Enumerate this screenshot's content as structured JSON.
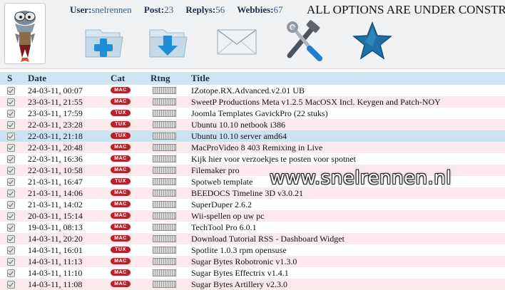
{
  "header": {
    "user_label": "User:",
    "user_value": "snelrennen",
    "post_label": "Post:",
    "post_value": "23",
    "replys_label": "Replys:",
    "replys_value": "56",
    "webbies_label": "Webbies:",
    "webbies_value": "67",
    "ticker": "ALL OPTIONS ARE UNDER CONSTRUC"
  },
  "toolbar": [
    "add-post-icon",
    "download-icon",
    "mail-icon",
    "tools-icon",
    "favorite-star-icon"
  ],
  "columns": {
    "s": "S",
    "date": "Date",
    "cat": "Cat",
    "rating": "Rtng",
    "title": "Title"
  },
  "rows": [
    {
      "date": "24-03-11, 00:07",
      "cat": "MAC",
      "title": "IZotope.RX.Advanced.v2.01 UB"
    },
    {
      "date": "23-03-11, 21:55",
      "cat": "MAC",
      "title": "SweetP Productions Meta v1.2.5 MacOSX Incl. Keygen and Patch-NOY"
    },
    {
      "date": "23-03-11, 17:59",
      "cat": "TUX",
      "title": "Joomla Templates GavickPro (22 stuks)"
    },
    {
      "date": "22-03-11, 23:28",
      "cat": "TUX",
      "title": "Ubuntu 10.10 netbook i386"
    },
    {
      "date": "22-03-11, 21:18",
      "cat": "TUX",
      "title": "Ubuntu 10.10 server amd64"
    },
    {
      "date": "22-03-11, 20:48",
      "cat": "MAC",
      "title": "MacProVideo 8 403 Remixing in Live"
    },
    {
      "date": "22-03-11, 16:36",
      "cat": "MAC",
      "title": "Kijk hier voor verzoekjes te posten voor spotnet"
    },
    {
      "date": "22-03-11, 10:58",
      "cat": "MAC",
      "title": "Filemaker pro"
    },
    {
      "date": "21-03-11, 16:47",
      "cat": "TUX",
      "title": "Spotweb template"
    },
    {
      "date": "21-03-11, 14:06",
      "cat": "MAC",
      "title": "BEEDOCS Timeline 3D v3.0.21"
    },
    {
      "date": "21-03-11, 14:02",
      "cat": "MAC",
      "title": "SuperDuper 2.6.2"
    },
    {
      "date": "20-03-11, 15:14",
      "cat": "MAC",
      "title": "Wii-spellen op uw pc"
    },
    {
      "date": "19-03-11, 08:13",
      "cat": "MAC",
      "title": "TechTool Pro 6.0.1"
    },
    {
      "date": "14-03-11, 20:20",
      "cat": "MAC",
      "title": "Download Tutorial RSS - Dashboard Widget"
    },
    {
      "date": "14-03-11, 16:01",
      "cat": "TUX",
      "title": "Spotlite 1.0.3 rpm opensuse"
    },
    {
      "date": "14-03-11, 11:13",
      "cat": "MAC",
      "title": "Sugar Bytes Robotronic v1.3.0"
    },
    {
      "date": "14-03-11, 11:10",
      "cat": "MAC",
      "title": "Sugar Bytes Effectrix v1.4.1"
    },
    {
      "date": "14-03-11, 11:08",
      "cat": "MAC",
      "title": "Sugar Bytes Artillery v2.3.0"
    }
  ],
  "watermark": "www.snelrennen.nl",
  "colors": {
    "cat_badge": "#b4242c",
    "header_row": "#cfe6f1",
    "row_alt": "#fbeaec",
    "row_highlight": "#cbe3ee"
  }
}
